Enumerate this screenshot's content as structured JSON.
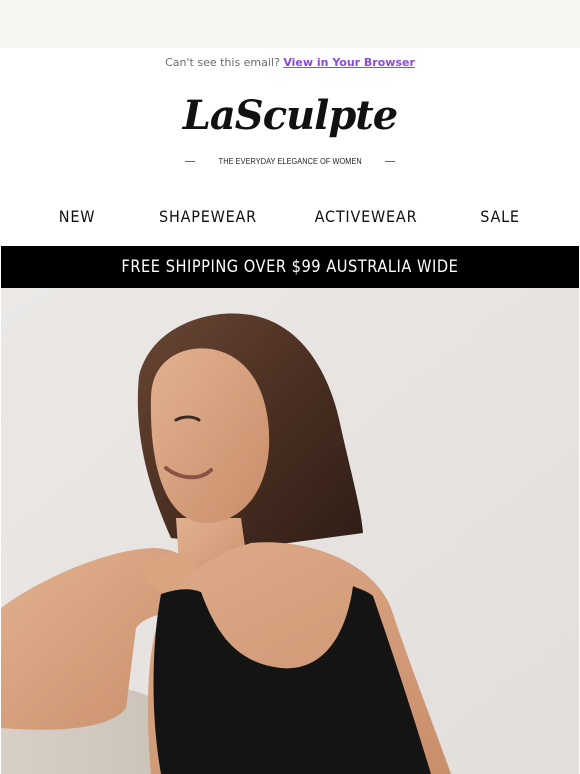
{
  "preheader": {
    "text": "Can't see this email?",
    "link": "View in Your Browser"
  },
  "brand": {
    "logo": "LaSculpte",
    "tagline": "THE EVERYDAY ELEGANCE OF WOMEN"
  },
  "nav": {
    "items": [
      {
        "label": "NEW"
      },
      {
        "label": "SHAPEWEAR"
      },
      {
        "label": "ACTIVEWEAR"
      },
      {
        "label": "SALE"
      }
    ]
  },
  "banner": {
    "text": "FREE SHIPPING OVER $99 AUSTRALIA WIDE"
  },
  "colors": {
    "page_background": "#f5f5f2",
    "banner_background": "#000000",
    "link": "#8a4bd6"
  }
}
